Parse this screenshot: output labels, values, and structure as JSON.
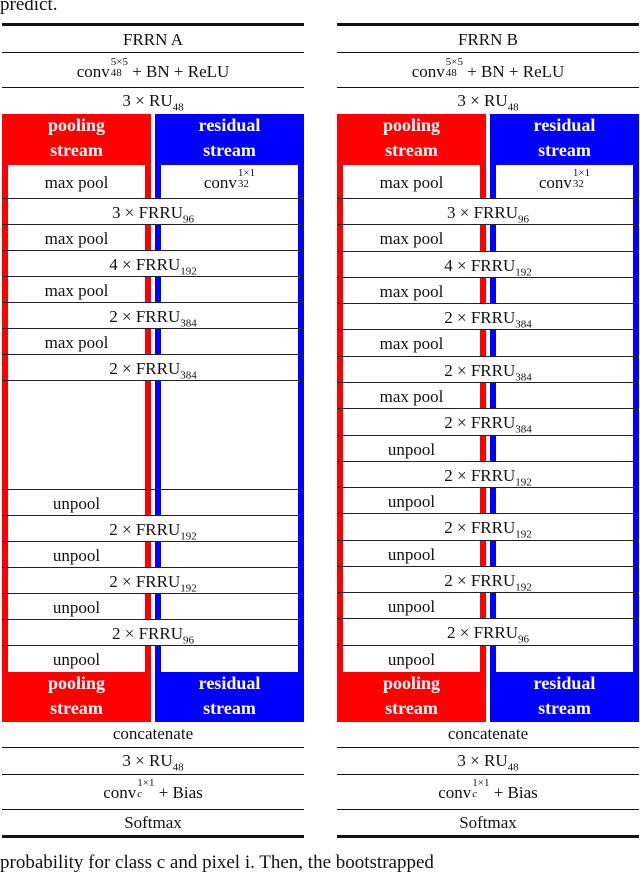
{
  "context": {
    "top_text": "predict.",
    "bottom_text": "probability for class c and pixel i. Then, the bootstrapped"
  },
  "colors": {
    "pooling_stream": "#ff0000",
    "residual_stream": "#0000ff"
  },
  "tables": [
    {
      "title": "FRRN A",
      "head": {
        "conv": {
          "base": "conv",
          "sup": "5×5",
          "sub": "48",
          "suffix": " + BN + ReLU"
        },
        "ru": {
          "prefix": "3 × RU",
          "sub": "48"
        }
      },
      "stream_labels": {
        "pooling": [
          "pooling",
          "stream"
        ],
        "residual": [
          "residual",
          "stream"
        ]
      },
      "first_row": {
        "pooling": "max pool",
        "residual": {
          "base": "conv",
          "sup": "1×1",
          "sub": "32"
        }
      },
      "rows": [
        {
          "kind": "full",
          "prefix": "3 × FRRU",
          "sub": "96"
        },
        {
          "kind": "pool",
          "text": "max pool"
        },
        {
          "kind": "full",
          "prefix": "4 × FRRU",
          "sub": "192"
        },
        {
          "kind": "pool",
          "text": "max pool"
        },
        {
          "kind": "full",
          "prefix": "2 × FRRU",
          "sub": "384"
        },
        {
          "kind": "pool",
          "text": "max pool"
        },
        {
          "kind": "full",
          "prefix": "2 × FRRU",
          "sub": "384"
        },
        {
          "kind": "empty",
          "text": ""
        },
        {
          "kind": "pool",
          "text": "unpool"
        },
        {
          "kind": "full",
          "prefix": "2 × FRRU",
          "sub": "192"
        },
        {
          "kind": "pool",
          "text": "unpool"
        },
        {
          "kind": "full",
          "prefix": "2 × FRRU",
          "sub": "192"
        },
        {
          "kind": "pool",
          "text": "unpool"
        },
        {
          "kind": "full",
          "prefix": "2 × FRRU",
          "sub": "96"
        },
        {
          "kind": "pool",
          "text": "unpool"
        }
      ],
      "tail": {
        "concat": "concatenate",
        "ru": {
          "prefix": "3 × RU",
          "sub": "48"
        },
        "conv": {
          "base": "conv",
          "sub": "c",
          "sup": "1×1",
          "suffix": " + Bias"
        },
        "softmax": "Softmax"
      }
    },
    {
      "title": "FRRN B",
      "head": {
        "conv": {
          "base": "conv",
          "sup": "5×5",
          "sub": "48",
          "suffix": " + BN + ReLU"
        },
        "ru": {
          "prefix": "3 × RU",
          "sub": "48"
        }
      },
      "stream_labels": {
        "pooling": [
          "pooling",
          "stream"
        ],
        "residual": [
          "residual",
          "stream"
        ]
      },
      "first_row": {
        "pooling": "max pool",
        "residual": {
          "base": "conv",
          "sup": "1×1",
          "sub": "32"
        }
      },
      "rows": [
        {
          "kind": "full",
          "prefix": "3 × FRRU",
          "sub": "96"
        },
        {
          "kind": "pool",
          "text": "max pool"
        },
        {
          "kind": "full",
          "prefix": "4 × FRRU",
          "sub": "192"
        },
        {
          "kind": "pool",
          "text": "max pool"
        },
        {
          "kind": "full",
          "prefix": "2 × FRRU",
          "sub": "384"
        },
        {
          "kind": "pool",
          "text": "max pool"
        },
        {
          "kind": "full",
          "prefix": "2 × FRRU",
          "sub": "384"
        },
        {
          "kind": "pool",
          "text": "max pool"
        },
        {
          "kind": "full",
          "prefix": "2 × FRRU",
          "sub": "384"
        },
        {
          "kind": "pool",
          "text": "unpool"
        },
        {
          "kind": "full",
          "prefix": "2 × FRRU",
          "sub": "192"
        },
        {
          "kind": "pool",
          "text": "unpool"
        },
        {
          "kind": "full",
          "prefix": "2 × FRRU",
          "sub": "192"
        },
        {
          "kind": "pool",
          "text": "unpool"
        },
        {
          "kind": "full",
          "prefix": "2 × FRRU",
          "sub": "192"
        },
        {
          "kind": "pool",
          "text": "unpool"
        },
        {
          "kind": "full",
          "prefix": "2 × FRRU",
          "sub": "96"
        },
        {
          "kind": "pool",
          "text": "unpool"
        }
      ],
      "tail": {
        "concat": "concatenate",
        "ru": {
          "prefix": "3 × RU",
          "sub": "48"
        },
        "conv": {
          "base": "conv",
          "sub": "c",
          "sup": "1×1",
          "suffix": " + Bias"
        },
        "softmax": "Softmax"
      }
    }
  ]
}
